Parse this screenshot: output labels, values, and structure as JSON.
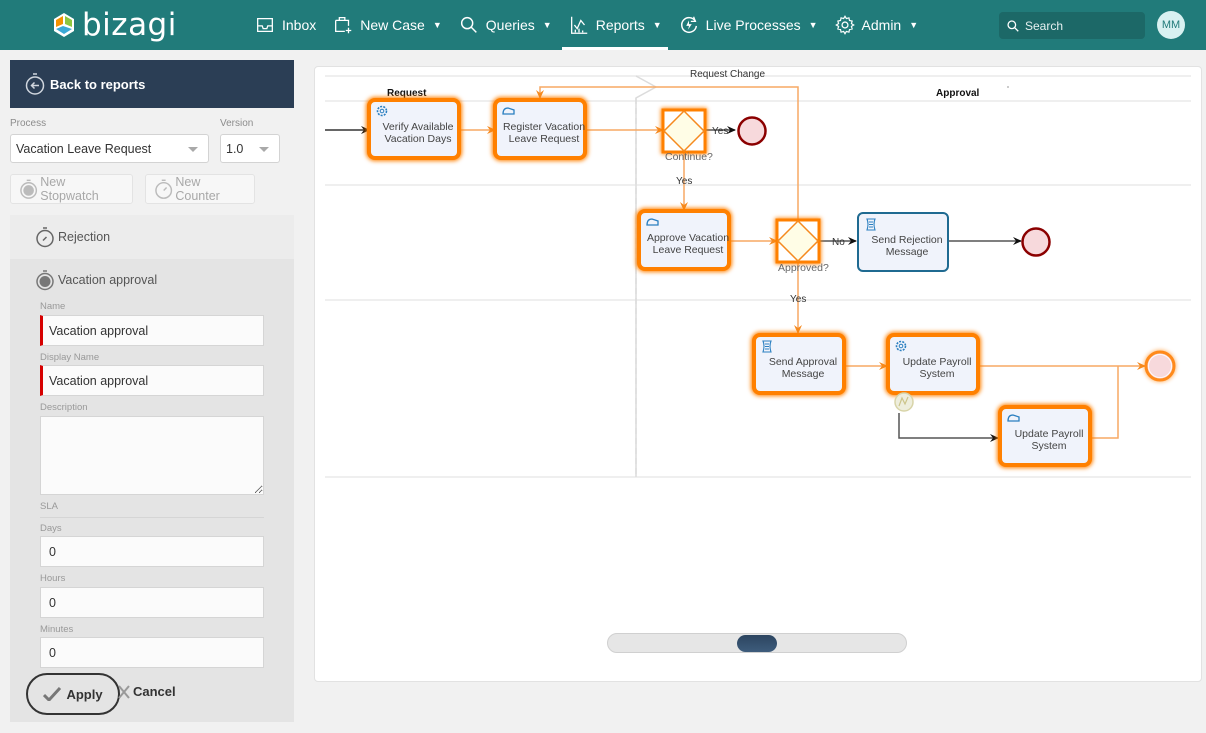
{
  "brand": {
    "name": "bizagi",
    "color": "#217b7a"
  },
  "nav": {
    "items": [
      {
        "label": "Inbox",
        "icon": "inbox-icon",
        "dropdown": false,
        "active": false
      },
      {
        "label": "New Case",
        "icon": "new-case-icon",
        "dropdown": true,
        "active": false
      },
      {
        "label": "Queries",
        "icon": "search-icon",
        "dropdown": true,
        "active": false
      },
      {
        "label": "Reports",
        "icon": "reports-chart-icon",
        "dropdown": true,
        "active": true
      },
      {
        "label": "Live Processes",
        "icon": "live-process-icon",
        "dropdown": true,
        "active": false
      },
      {
        "label": "Admin",
        "icon": "gear-icon",
        "dropdown": true,
        "active": false
      }
    ],
    "search_placeholder": "Search",
    "user_initials": "MM"
  },
  "left_panel": {
    "back_label": "Back to reports",
    "process_label": "Process",
    "process_value": "Vacation Leave Request",
    "version_label": "Version",
    "version_value": "1.0",
    "new_stopwatch_label": "New Stopwatch",
    "new_counter_label": "New Counter",
    "stopwatches": [
      {
        "name": "Rejection",
        "icon": "counter-icon",
        "selected": false
      },
      {
        "name": "Vacation approval",
        "icon": "stopwatch-icon",
        "selected": true
      }
    ],
    "form": {
      "name_label": "Name",
      "name_value": "Vacation approval",
      "display_name_label": "Display Name",
      "display_name_value": "Vacation approval",
      "description_label": "Description",
      "description_value": "",
      "sla_label": "SLA",
      "days_label": "Days",
      "days_value": "0",
      "hours_label": "Hours",
      "hours_value": "0",
      "minutes_label": "Minutes",
      "minutes_value": "0"
    },
    "apply_label": "Apply",
    "cancel_label": "Cancel"
  },
  "diagram": {
    "phases": [
      "Request",
      "Approval"
    ],
    "tasks": {
      "verify": "Verify Available|Vacation Days",
      "register": "Register Vacation|Leave Request",
      "approve": "Approve Vacation|Leave Request",
      "send_rejection": "Send Rejection|Message",
      "send_approval": "Send Approval|Message",
      "update_payroll_1": "Update Payroll|System",
      "update_payroll_2": "Update Payroll|System"
    },
    "gateways": {
      "continue": "Continue?",
      "approved": "Approved?"
    },
    "flow_labels": {
      "request_change": "Request Change",
      "yes_end": "Yes",
      "yes_continue": "Yes",
      "no": "No",
      "yes_approved": "Yes"
    },
    "highlight_color": "#ff8000",
    "zoom_level_fraction": 0.5
  }
}
